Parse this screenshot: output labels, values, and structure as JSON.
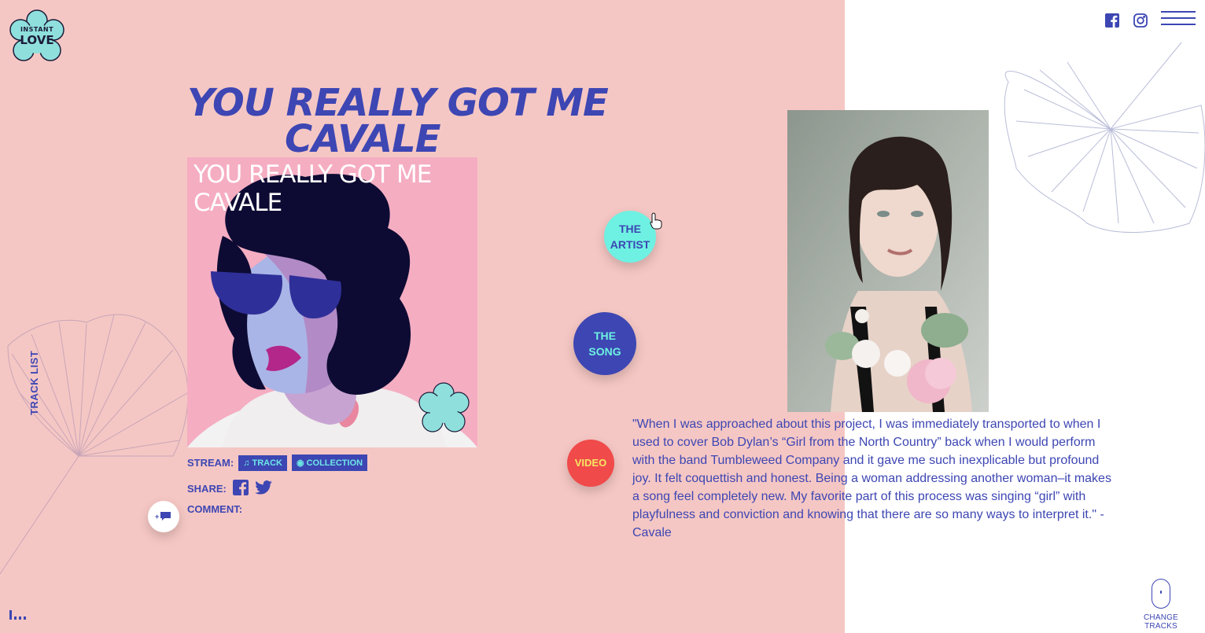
{
  "brand": {
    "logo_top": "INSTANT",
    "logo_bottom": "LOVE"
  },
  "header": {
    "facebook_icon": "facebook-icon",
    "instagram_icon": "instagram-icon",
    "menu_icon": "hamburger-menu-icon"
  },
  "sidebar": {
    "track_list_label": "TRACK LIST"
  },
  "song": {
    "title_line1": "YOU REALLY GOT ME",
    "title_line2": "CAVALE",
    "cover_line1": "YOU REALLY GOT ME",
    "cover_line2": "CAVALE"
  },
  "meta": {
    "stream_label": "STREAM:",
    "track_button": "TRACK",
    "collection_button": "COLLECTION",
    "share_label": "SHARE:",
    "comment_label": "COMMENT:"
  },
  "bubbles": {
    "artist_line1": "THE",
    "artist_line2": "ARTIST",
    "song_line1": "THE",
    "song_line2": "SONG",
    "video": "VIDEO"
  },
  "quote": "\"When I was approached about this project, I was immediately transported to when I used to cover Bob Dylan’s “Girl from the North Country” back when I would perform with the band Tumbleweed Company and it gave me such inexplicable but profound joy. It felt coquettish and honest. Being a woman addressing another woman–it makes a song feel completely new. My favorite part of this process was singing “girl” with playfulness and conviction and knowing that there are so many ways to interpret it.\" - Cavale",
  "footer": {
    "change_tracks_label": "CHANGE TRACKS"
  },
  "colors": {
    "pink_bg": "#f5c7c4",
    "accent_blue": "#3d46b3",
    "aqua": "#6ef1e2",
    "red": "#f04a4a",
    "yellow": "#f5e664"
  }
}
